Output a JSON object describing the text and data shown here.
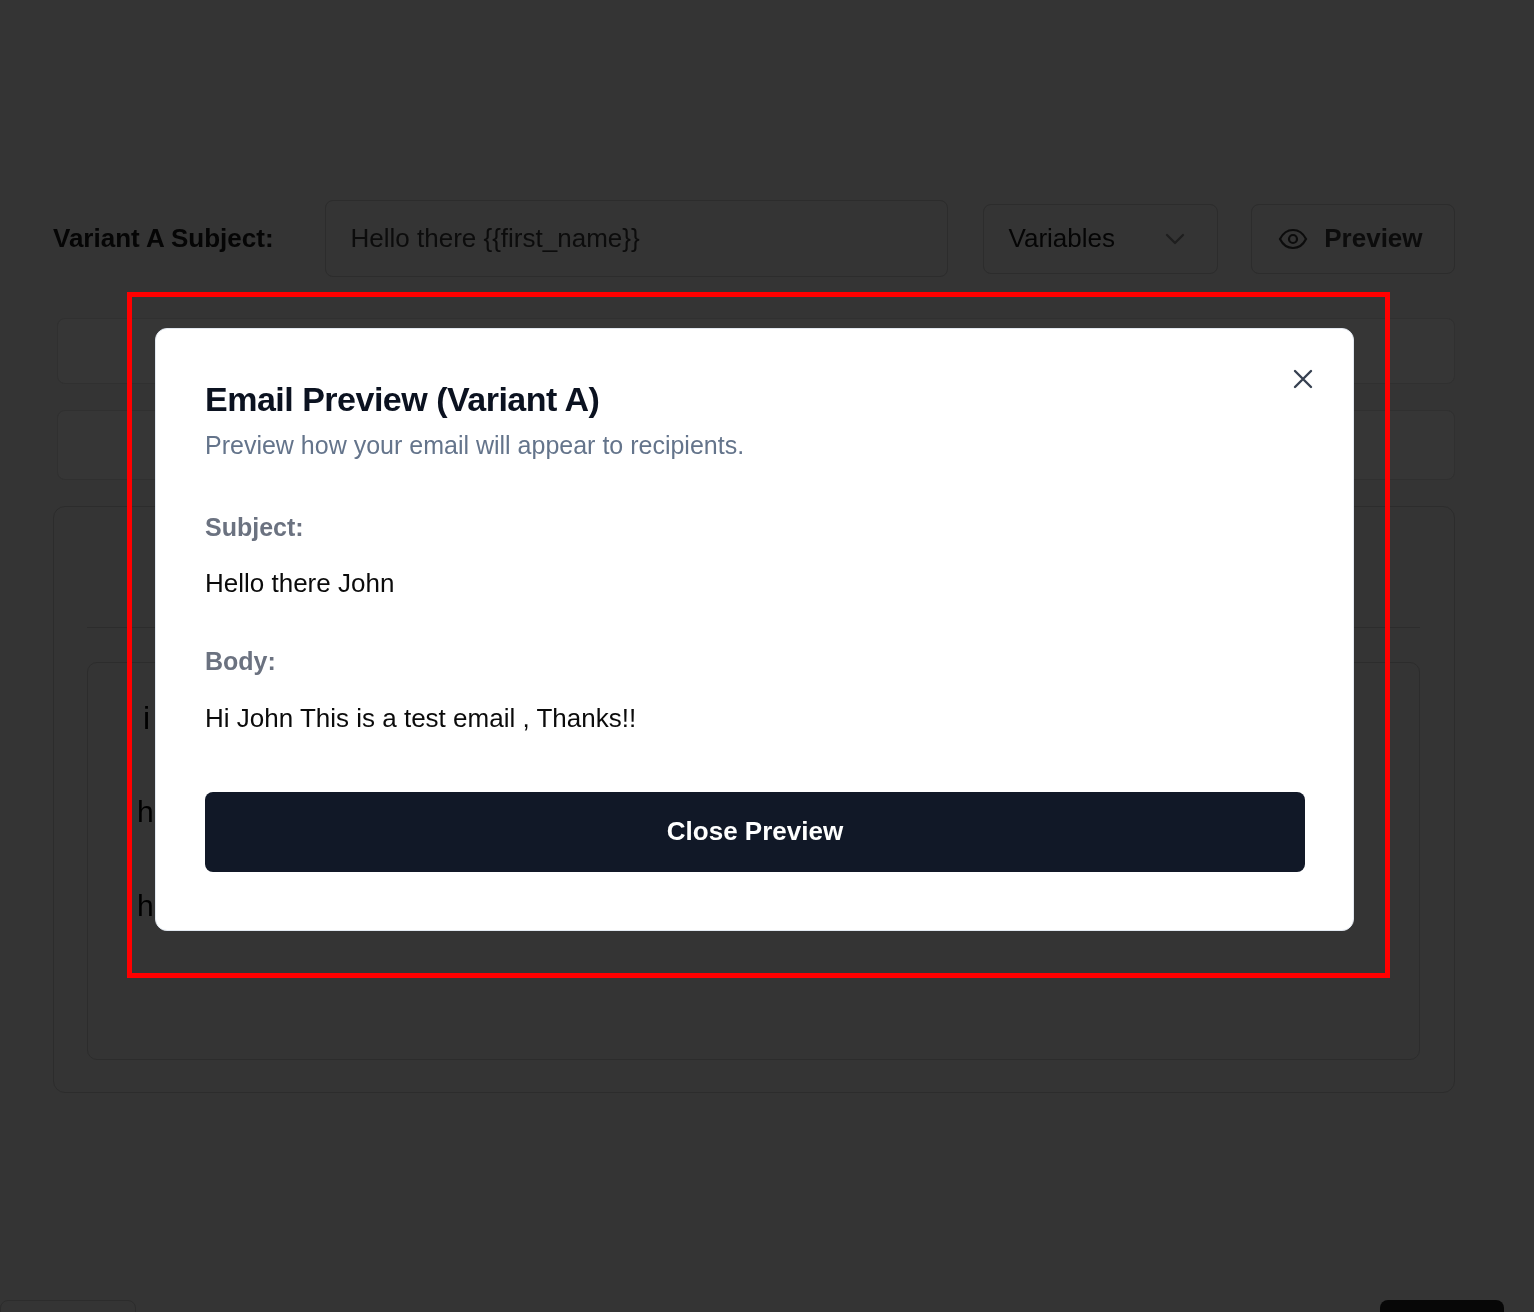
{
  "page": {
    "subject_label": "Variant A Subject:",
    "subject_input": "Hello there {{first_name}}",
    "variables_dropdown": "Variables",
    "preview_button": "Preview",
    "editor_lines": [
      "i",
      "h",
      "h"
    ]
  },
  "modal": {
    "title": "Email Preview (Variant A)",
    "description": "Preview how your email will appear to recipients.",
    "fields": [
      {
        "label": "Subject:",
        "value": "Hello there John"
      },
      {
        "label": "Body:",
        "value": "Hi John This is a test email , Thanks!!"
      }
    ],
    "close_button": "Close Preview"
  }
}
